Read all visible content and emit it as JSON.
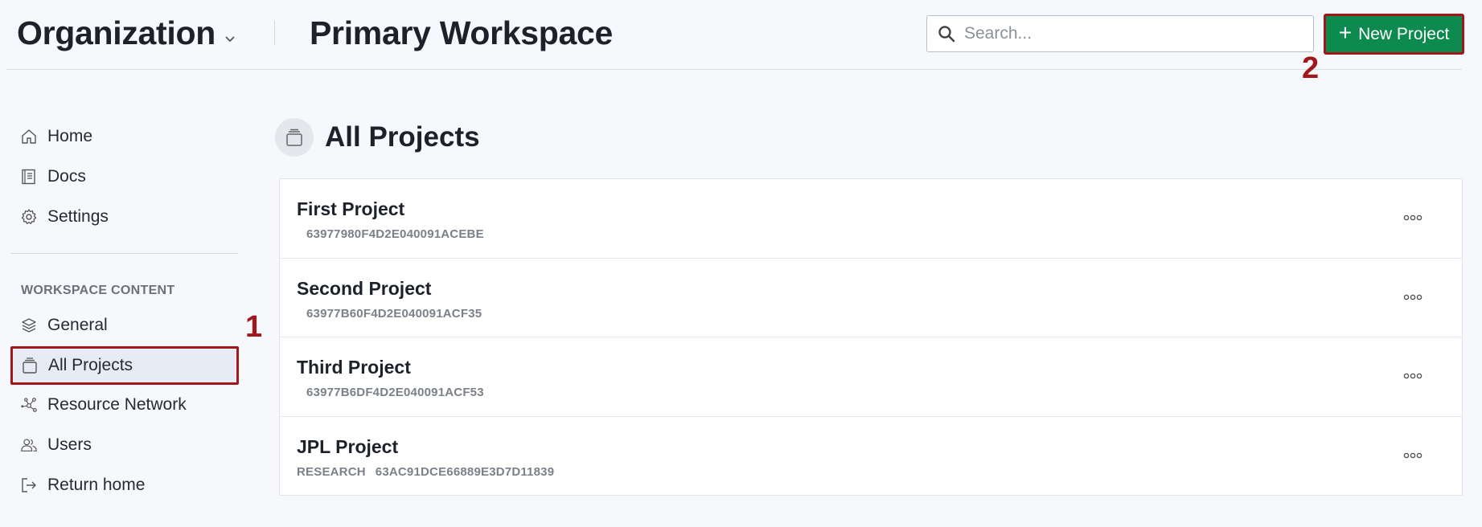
{
  "header": {
    "organization": "Organization",
    "workspace": "Primary Workspace",
    "search_placeholder": "Search...",
    "new_project_label": "New Project"
  },
  "annotations": [
    "1",
    "2"
  ],
  "sidebar": {
    "items": [
      {
        "label": "Home",
        "icon": "home-icon"
      },
      {
        "label": "Docs",
        "icon": "docs-icon"
      },
      {
        "label": "Settings",
        "icon": "gear-icon"
      }
    ],
    "section_label": "WORKSPACE CONTENT",
    "section_items": [
      {
        "label": "General",
        "icon": "layers-icon"
      },
      {
        "label": "All Projects",
        "icon": "projects-icon",
        "active": true
      },
      {
        "label": "Resource Network",
        "icon": "network-icon"
      },
      {
        "label": "Users",
        "icon": "users-icon"
      },
      {
        "label": "Return home",
        "icon": "logout-icon"
      }
    ]
  },
  "main": {
    "title": "All Projects",
    "projects": [
      {
        "name": "First Project",
        "tag": "",
        "id": "63977980F4D2E040091ACEBE"
      },
      {
        "name": "Second Project",
        "tag": "",
        "id": "63977B60F4D2E040091ACF35"
      },
      {
        "name": "Third Project",
        "tag": "",
        "id": "63977B6DF4D2E040091ACF53"
      },
      {
        "name": "JPL Project",
        "tag": "RESEARCH",
        "id": "63AC91DCE66889E3D7D11839"
      }
    ]
  },
  "colors": {
    "accent_green": "#0d8a4e",
    "highlight_red": "#a1171c",
    "active_bg": "#e6ebf5"
  }
}
